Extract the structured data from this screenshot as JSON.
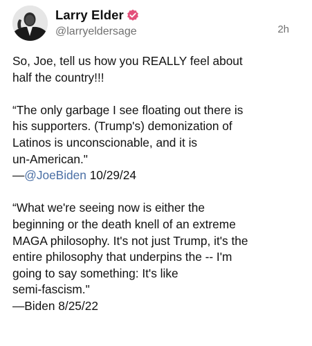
{
  "post": {
    "author": {
      "display_name": "Larry Elder",
      "handle": "@larryeldersage",
      "verified_icon": "verified-badge-icon",
      "verified_color": "#e3507a"
    },
    "timestamp": "2h",
    "intro_line1": "So, Joe, tell us how you REALLY feel about",
    "intro_line2": "half the country!!!",
    "quote1": {
      "line1": "“The only garbage I see floating out there is",
      "line2": "his supporters. (Trump's) demonization of",
      "line3": "Latinos is unconscionable, and it is",
      "line4": "un-American.\"",
      "attribution_dash": "—",
      "attribution_mention": "@JoeBiden",
      "attribution_date": " 10/29/24"
    },
    "quote2": {
      "line1": "“What we're seeing now is either the",
      "line2": "beginning or the death knell of an extreme",
      "line3": "MAGA philosophy. It's not just Trump, it's the",
      "line4": "entire philosophy that underpins the -- I'm",
      "line5": "going to say something: It's like",
      "line6": "semi-fascism.\"",
      "attribution": "—Biden 8/25/22"
    }
  }
}
